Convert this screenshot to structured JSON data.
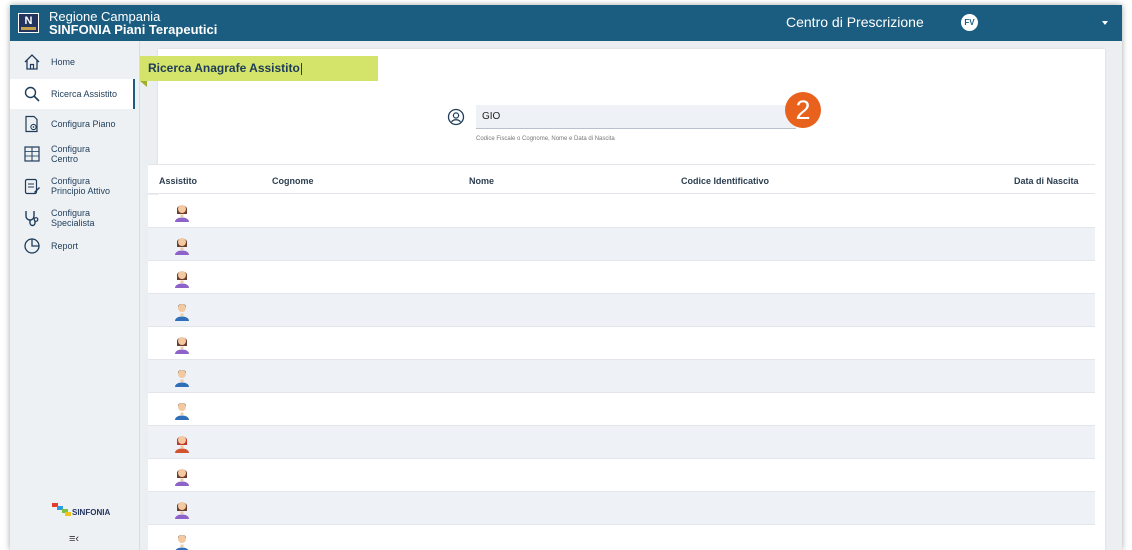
{
  "header": {
    "brand_line1": "Regione Campania",
    "brand_line2": "SINFONIA Piani Terapeutici",
    "logo_letter": "N",
    "center_name": "Centro di Prescrizione",
    "user_initials": "FV",
    "bg_color": "#1b5d80"
  },
  "sidebar": {
    "items": [
      {
        "label": "Home",
        "icon": "home-icon"
      },
      {
        "label": "Ricerca Assistito",
        "icon": "search-icon"
      },
      {
        "label": "Configura Piano",
        "icon": "document-gear-icon"
      },
      {
        "label": "Configura\nCentro",
        "icon": "building-icon"
      },
      {
        "label": "Configura\nPrincipio Attivo",
        "icon": "clipboard-edit-icon"
      },
      {
        "label": "Configura\nSpecialista",
        "icon": "stethoscope-icon"
      },
      {
        "label": "Report",
        "icon": "pie-chart-icon"
      }
    ],
    "footer_brand": "SINFONIA"
  },
  "main": {
    "title": "Ricerca Anagrafe Assistito",
    "search": {
      "value": "GIO",
      "help": "Codice Fiscale o Cognome, Nome e Data di Nascita"
    },
    "step_badge": "2",
    "table": {
      "columns": [
        "Assistito",
        "Cognome",
        "Nome",
        "Codice Identificativo",
        "Data di Nascita"
      ],
      "rows": [
        {
          "avatar": "female"
        },
        {
          "avatar": "female"
        },
        {
          "avatar": "female"
        },
        {
          "avatar": "male"
        },
        {
          "avatar": "female"
        },
        {
          "avatar": "male"
        },
        {
          "avatar": "male"
        },
        {
          "avatar": "female-red"
        },
        {
          "avatar": "female"
        },
        {
          "avatar": "female"
        },
        {
          "avatar": "male"
        }
      ]
    }
  },
  "colors": {
    "accent": "#1b5d80",
    "title_highlight": "#d4e36a",
    "badge": "#e8621e",
    "avatar_female": "#8d63c9",
    "avatar_male": "#2e6fb8",
    "avatar_female_red": "#d2542e"
  }
}
